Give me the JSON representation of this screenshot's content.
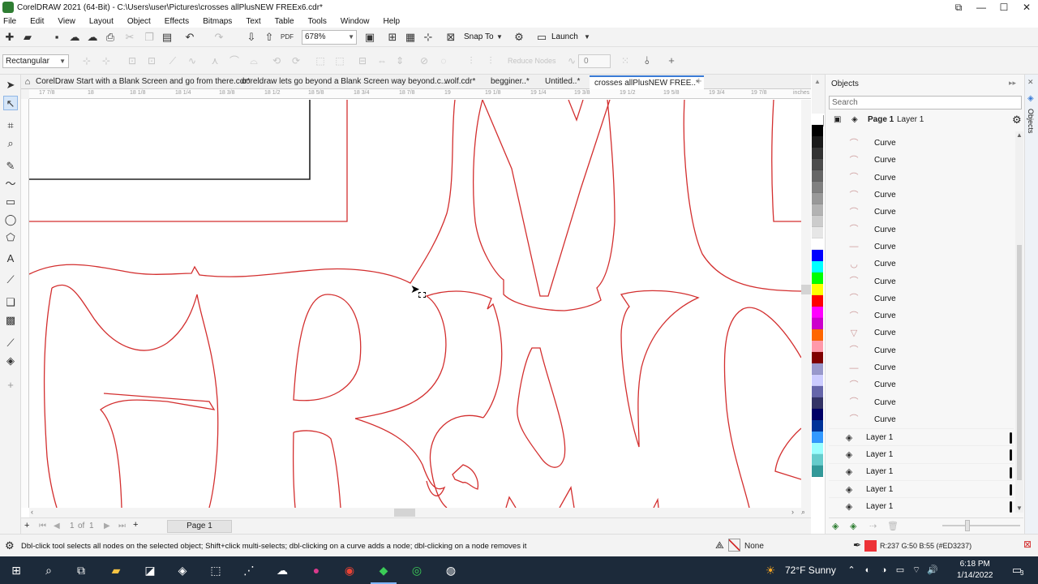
{
  "window": {
    "title": "CorelDRAW 2021 (64-Bit) - C:\\Users\\user\\Pictures\\crosses allPlusNEW FREEx6.cdr*",
    "controls": [
      "⧉",
      "—",
      "☐",
      "✕"
    ]
  },
  "menu": [
    "File",
    "Edit",
    "View",
    "Layout",
    "Object",
    "Effects",
    "Bitmaps",
    "Text",
    "Table",
    "Tools",
    "Window",
    "Help"
  ],
  "toolbar": {
    "zoom": "678%",
    "snap_label": "Snap To",
    "launch_label": "Launch"
  },
  "property_bar": {
    "shape_mode": "Rectangular",
    "node_count": "0",
    "reduce_nodes_label": "Reduce Nodes"
  },
  "tabs": [
    "CorelDraw Start with a Blank Screen and go from there.cdr*",
    "coreldraw lets go beyond a Blank Screen way beyond.c...",
    "wolf.cdr*",
    "begginer..*",
    "Untitled..*",
    "crosses allPlusNEW FREE..*"
  ],
  "ruler": {
    "units": "inches",
    "ticks": [
      "17 7/8",
      "18",
      "18 1/8",
      "18 1/4",
      "18 3/8",
      "18 1/2",
      "18 5/8",
      "18 3/4",
      "18 7/8",
      "19",
      "19 1/8",
      "19 1/4",
      "19 3/8",
      "19 1/2",
      "19 5/8",
      "19 3/4",
      "19 7/8"
    ]
  },
  "page_nav": {
    "position": "1",
    "of": "of",
    "total": "1",
    "page_tab": "Page 1"
  },
  "objects_panel": {
    "title": "Objects",
    "search_placeholder": "Search",
    "page": "Page 1",
    "layer": "Layer 1",
    "curves": [
      "Curve",
      "Curve",
      "Curve",
      "Curve",
      "Curve",
      "Curve",
      "Curve",
      "Curve",
      "Curve",
      "Curve",
      "Curve",
      "Curve",
      "Curve",
      "Curve",
      "Curve",
      "Curve",
      "Curve"
    ],
    "layers": [
      "Layer 1",
      "Layer 1",
      "Layer 1",
      "Layer 1",
      "Layer 1"
    ],
    "side_tab": "Objects"
  },
  "palette": [
    "#ffffff",
    "#000000",
    "#1a1a1a",
    "#333333",
    "#4d4d4d",
    "#666666",
    "#808080",
    "#999999",
    "#b3b3b3",
    "#cccccc",
    "#e6e6e6",
    "#ffffff",
    "#0000ff",
    "#00ffff",
    "#00ff00",
    "#ffff00",
    "#ff0000",
    "#ff00ff",
    "#cc00cc",
    "#ff6600",
    "#ff99aa",
    "#800000",
    "#9999cc",
    "#ccccff",
    "#6666aa",
    "#333366",
    "#000066",
    "#003399",
    "#3399ff",
    "#99ffff",
    "#66cccc",
    "#339999"
  ],
  "status": {
    "hint": "Dbl-click tool selects all nodes on the selected object; Shift+click multi-selects; dbl-clicking on a curve adds a node; dbl-clicking on a node removes it",
    "fill": "None",
    "color_readout": "R:237 G:50 B:55 (#ED3237)",
    "outline_color": "#ed3237"
  },
  "taskbar": {
    "weather": "72°F  Sunny",
    "time": "6:18 PM",
    "date": "1/14/2022",
    "notification_count": "3"
  },
  "colors": {
    "accent": "#3a7bd5",
    "curve_stroke": "#d32f2f",
    "taskbar": "#1c2a3a"
  }
}
